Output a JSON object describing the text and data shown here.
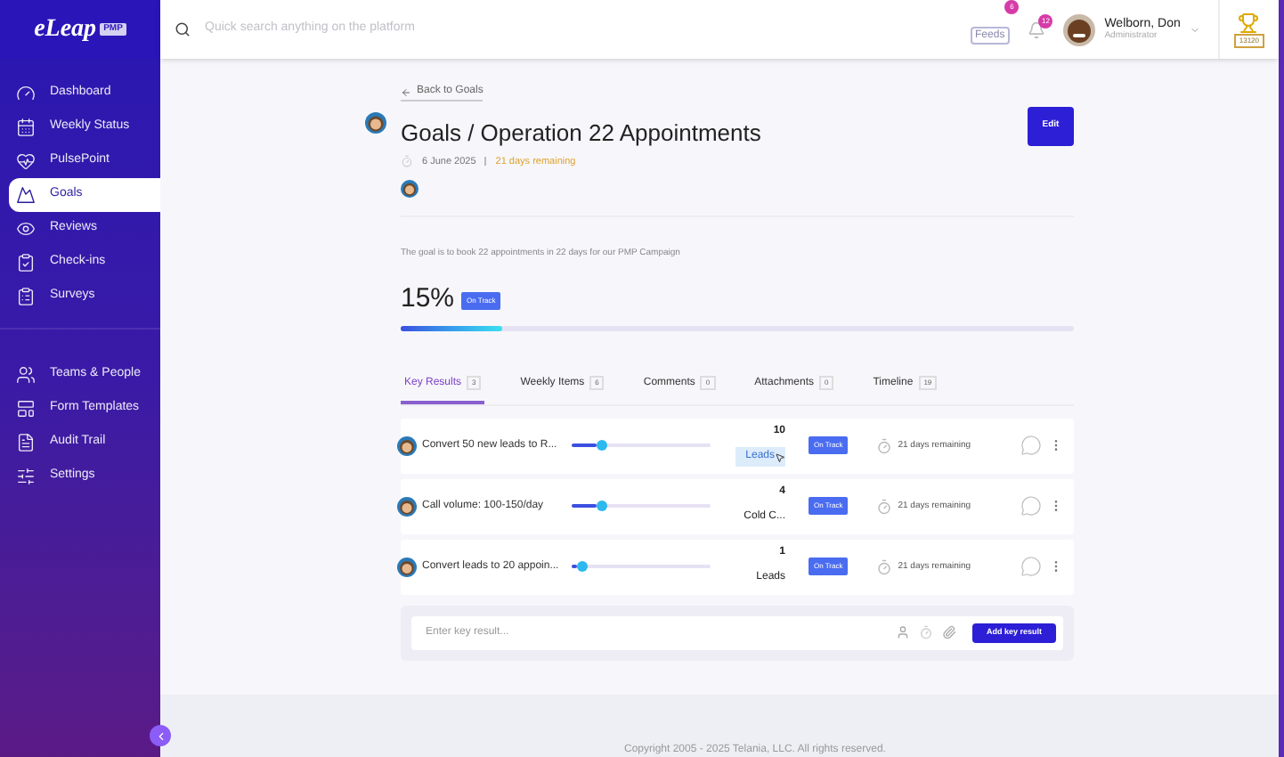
{
  "logo": {
    "name": "eLeap",
    "badge": "PMP"
  },
  "sidebar": {
    "items": [
      {
        "label": "Dashboard",
        "selected": false
      },
      {
        "label": "Weekly Status",
        "selected": false
      },
      {
        "label": "PulsePoint",
        "selected": false
      },
      {
        "label": "Goals",
        "selected": true
      },
      {
        "label": "Reviews",
        "selected": false
      },
      {
        "label": "Check-ins",
        "selected": false
      },
      {
        "label": "Surveys",
        "selected": false
      }
    ],
    "items_2": [
      {
        "label": "Teams & People",
        "selected": false
      },
      {
        "label": "Form Templates",
        "selected": false
      },
      {
        "label": "Audit Trail",
        "selected": false
      },
      {
        "label": "Settings",
        "selected": false
      }
    ]
  },
  "search": {
    "placeholder": "Quick search anything on the platform"
  },
  "header": {
    "feeds": "Feeds",
    "feeds_count": "6",
    "notifications_count": "12",
    "user_name": "Welborn, Don",
    "user_role": "Administrator",
    "points": "13120"
  },
  "goal": {
    "back": "Back to Goals",
    "title": "Goals / Operation 22 Appointments",
    "edit": "Edit",
    "date": "6 June 2025",
    "remaining": "21 days remaining",
    "description": "The goal is to book 22 appointments in 22 days for our PMP Campaign",
    "percent": "15%",
    "status": "On Track",
    "level": 0.15
  },
  "tabs": [
    {
      "label": "Key Results",
      "count": "3",
      "selected": true
    },
    {
      "label": "Weekly Items",
      "count": "6",
      "selected": false
    },
    {
      "label": "Comments",
      "count": "0",
      "selected": false
    },
    {
      "label": "Attachments",
      "count": "0",
      "selected": false
    },
    {
      "label": "Timeline",
      "count": "19",
      "selected": false
    }
  ],
  "key_results": [
    {
      "title": "Convert 50 new leads to R...",
      "level": 0.22,
      "value": "10",
      "unit": "Leads",
      "hovered": true,
      "status": "On Track",
      "remaining": "21 days remaining"
    },
    {
      "title": "Call volume: 100-150/day",
      "level": 0.22,
      "value": "4",
      "unit": "Cold C...",
      "hovered": false,
      "status": "On Track",
      "remaining": "21 days remaining"
    },
    {
      "title": "Convert leads to 20 appoin...",
      "level": 0.08,
      "value": "1",
      "unit": "Leads",
      "hovered": false,
      "status": "On Track",
      "remaining": "21 days remaining"
    }
  ],
  "new_key_result": {
    "placeholder": "Enter key result...",
    "button": "Add key result"
  },
  "footer": {
    "copyright": "Copyright 2005 - 2025 Telania, LLC. All rights reserved."
  }
}
